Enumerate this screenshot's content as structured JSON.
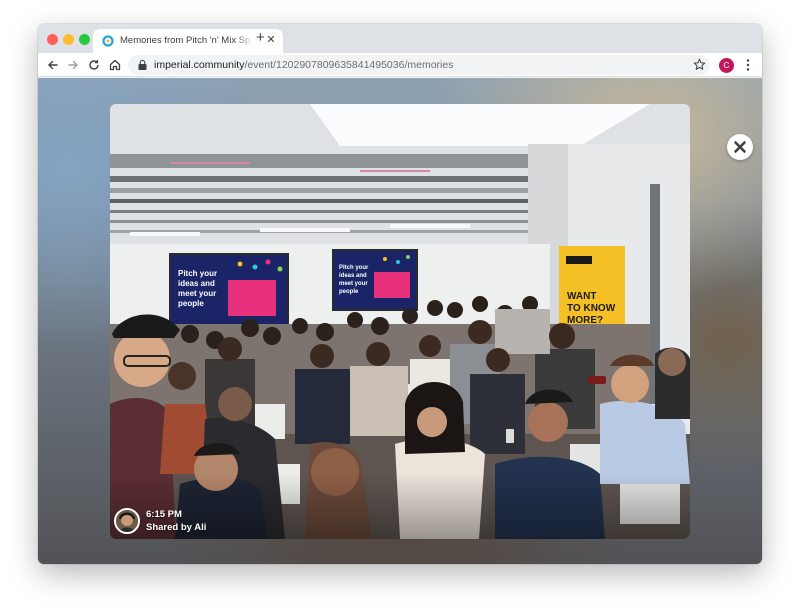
{
  "browser": {
    "tab_title": "Memories from Pitch 'n' Mix Sp",
    "tab_close_icon": "close-icon",
    "new_tab_label": "+",
    "url_host": "imperial.community",
    "url_path": "/event/1202907809635841495036/memories",
    "profile_initial": "C"
  },
  "lightbox": {
    "photo_description": "event photo",
    "screens": {
      "left_text": [
        "Pitch your",
        "ideas and",
        "meet your",
        "people"
      ],
      "right_text": [
        "Pitch your",
        "ideas and",
        "meet your",
        "people"
      ]
    },
    "banner_text": [
      "WANT",
      "TO KNOW",
      "MORE?"
    ],
    "caption_time": "6:15 PM",
    "caption_shared_by": "Shared by Ali"
  },
  "colors": {
    "accent_profile": "#c2185b",
    "screen_bg": "#1a2466",
    "banner_bg": "#f4c026"
  }
}
